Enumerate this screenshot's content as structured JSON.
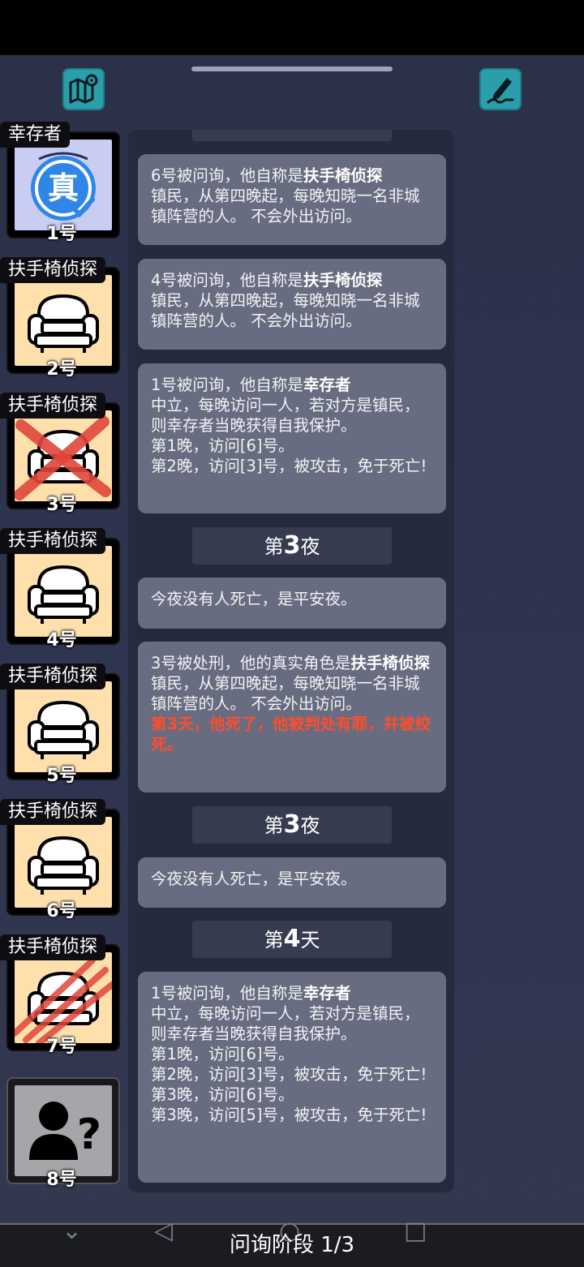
{
  "toolbar": {
    "map_icon": "map-pin-icon",
    "notes_icon": "pencil-notes-icon"
  },
  "players": [
    {
      "role": "幸存者",
      "number": "1号",
      "portrait": "truth-badge",
      "badge_text": "真",
      "status": "alive"
    },
    {
      "role": "扶手椅侦探",
      "number": "2号",
      "portrait": "armchair",
      "status": "alive"
    },
    {
      "role": "扶手椅侦探",
      "number": "3号",
      "portrait": "armchair",
      "status": "executed"
    },
    {
      "role": "扶手椅侦探",
      "number": "4号",
      "portrait": "armchair",
      "status": "alive"
    },
    {
      "role": "扶手椅侦探",
      "number": "5号",
      "portrait": "armchair",
      "status": "alive"
    },
    {
      "role": "扶手椅侦探",
      "number": "6号",
      "portrait": "armchair",
      "status": "alive"
    },
    {
      "role": "扶手椅侦探",
      "number": "7号",
      "portrait": "armchair",
      "status": "attacked"
    },
    {
      "role": "",
      "number": "8号",
      "portrait": "unknown-person",
      "status": "unknown"
    }
  ],
  "log": {
    "msg1": {
      "prefix": "6号被问询，他自称是",
      "role": "扶手椅侦探",
      "desc": "镇民，从第四晚起，每晚知晓一名非城镇阵营的人。 不会外出访问。"
    },
    "msg2": {
      "prefix": "4号被问询，他自称是",
      "role": "扶手椅侦探",
      "desc": "镇民，从第四晚起，每晚知晓一名非城镇阵营的人。 不会外出访问。"
    },
    "msg3": {
      "prefix": "1号被问询，他自称是",
      "role": "幸存者",
      "desc": "中立，每晚访问一人，若对方是镇民，则幸存者当晚获得自我保护。",
      "line1": "第1晚，访问[6]号。",
      "line2": "第2晚，访问[3]号，被攻击，免于死亡!"
    },
    "divider1": {
      "pre": "第",
      "num": "3",
      "post": "夜"
    },
    "msg4": "今夜没有人死亡，是平安夜。",
    "msg5": {
      "prefix": "3号被处刑，他的真实角色是",
      "role": "扶手椅侦探",
      "desc": "镇民，从第四晚起，每晚知晓一名非城镇阵营的人。 不会外出访问。",
      "verdict": "第3天，他死了，他被判处有罪，并被绞死。"
    },
    "divider2": {
      "pre": "第",
      "num": "3",
      "post": "夜"
    },
    "msg6": "今夜没有人死亡，是平安夜。",
    "divider3": {
      "pre": "第",
      "num": "4",
      "post": "天"
    },
    "msg7": {
      "prefix": "1号被问询，他自称是",
      "role": "幸存者",
      "desc": "中立，每晚访问一人，若对方是镇民，则幸存者当晚获得自我保护。",
      "line1": "第1晚，访问[6]号。",
      "line2": "第2晚，访问[3]号，被攻击，免于死亡!",
      "line3": "第3晚，访问[6]号。",
      "line4": "第3晚，访问[5]号，被攻击，免于死亡!"
    }
  },
  "phase": "问询阶段 1/3"
}
